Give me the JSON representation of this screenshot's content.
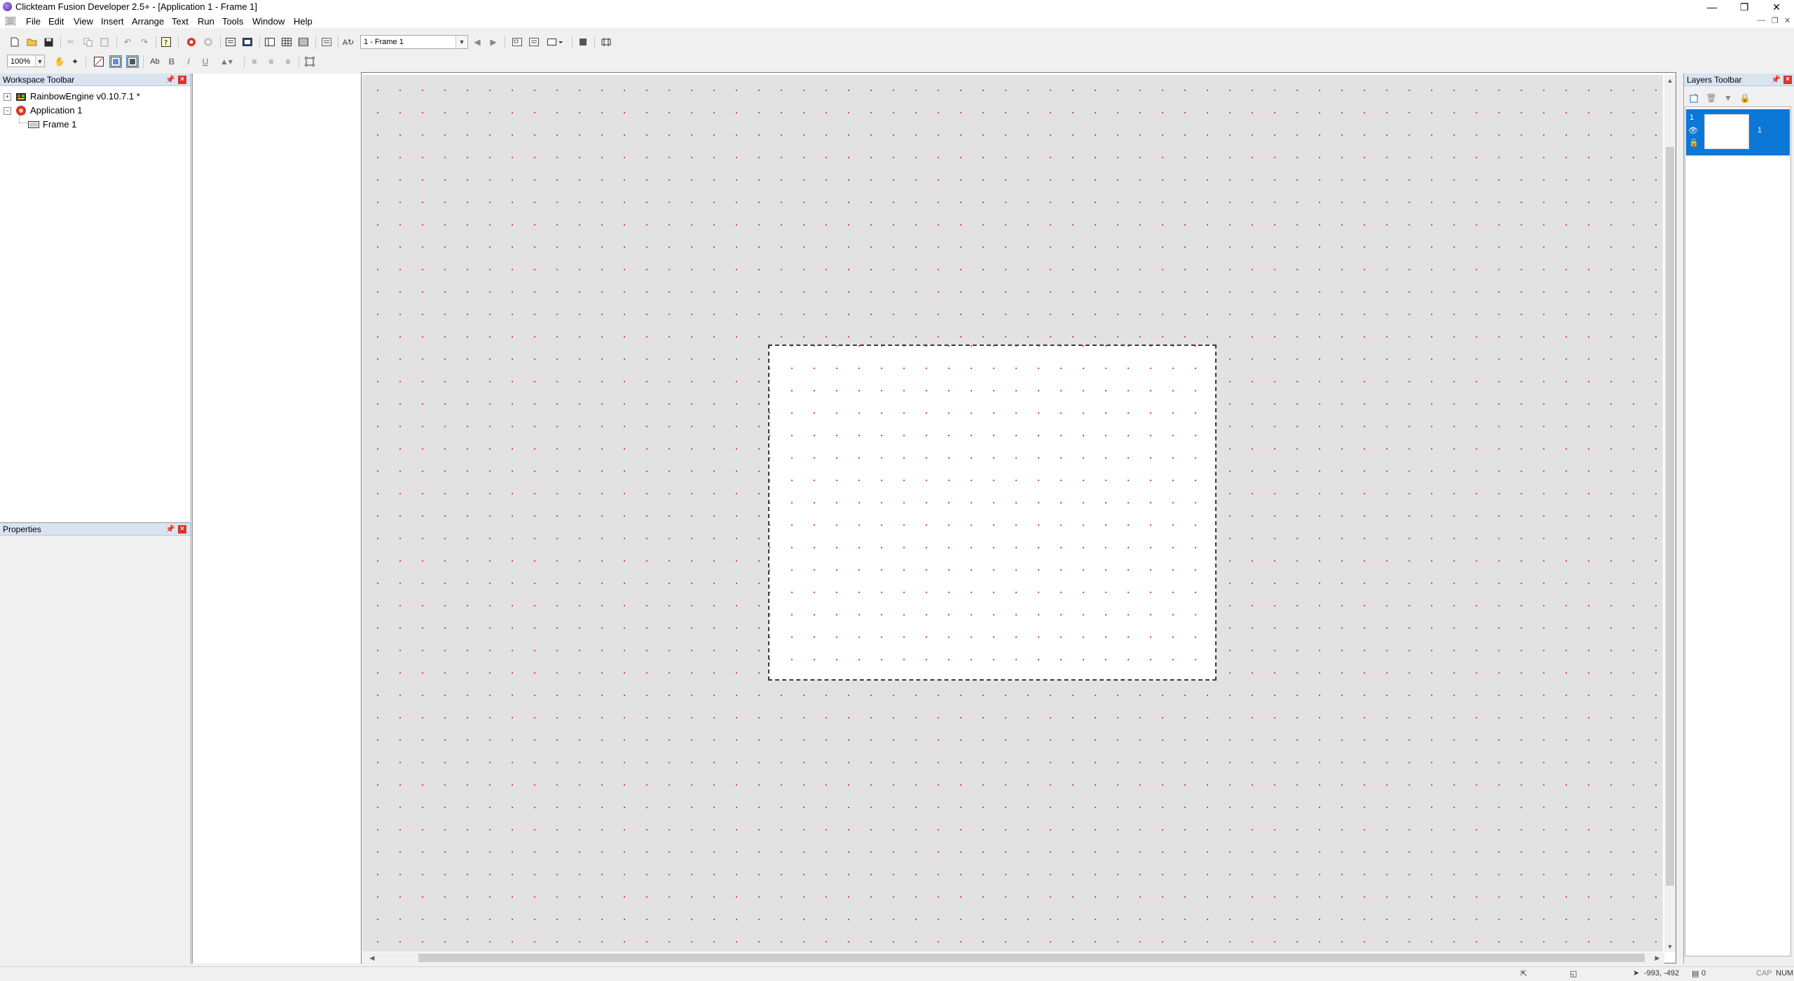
{
  "window": {
    "title": "Clickteam Fusion Developer 2.5+ - [Application 1 - Frame 1]",
    "minimize_glyph": "—",
    "restore_glyph": "❐",
    "close_glyph": "✕"
  },
  "menu": {
    "items": [
      "File",
      "Edit",
      "View",
      "Insert",
      "Arrange",
      "Text",
      "Run",
      "Tools",
      "Window",
      "Help"
    ]
  },
  "toolbar": {
    "frame_select": "1 - Frame 1",
    "zoom": "100%"
  },
  "workspace": {
    "title": "Workspace Toolbar",
    "tree": {
      "root_label": "RainbowEngine v0.10.7.1 *",
      "app_label": "Application 1",
      "frame_label": "Frame 1"
    }
  },
  "properties": {
    "title": "Properties"
  },
  "layers": {
    "title": "Layers Toolbar",
    "items": [
      {
        "number": "1",
        "count": "1"
      }
    ]
  },
  "status": {
    "coords": "-993, -492",
    "objects": "0",
    "caps": "CAP",
    "num": "NUM"
  },
  "colors": {
    "panel_header": "#d9e4f1",
    "layer_selected": "#0b78d7",
    "grid_dot": "#d65050",
    "canvas_bg": "#e2e2e2",
    "close_red": "#d9342b"
  }
}
